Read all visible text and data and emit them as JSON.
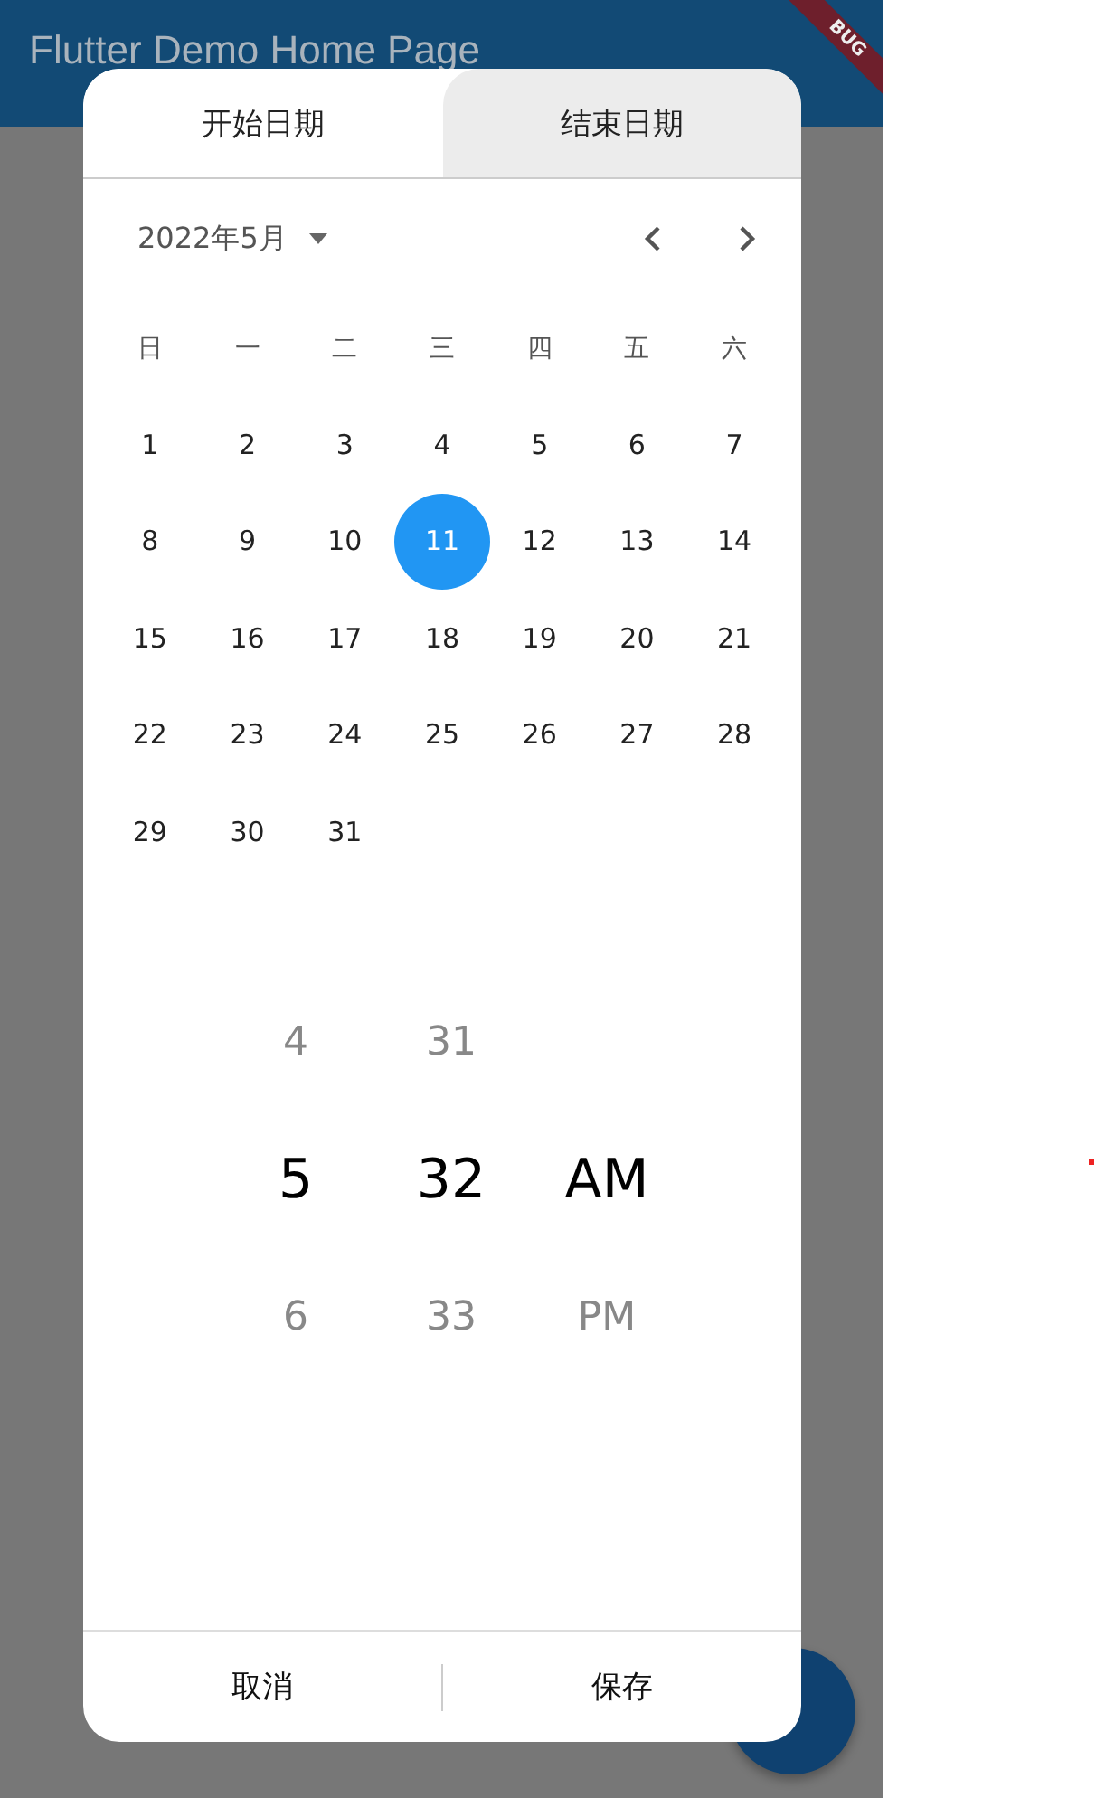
{
  "app_bar": {
    "title": "Flutter Demo Home Page"
  },
  "debug_banner": {
    "label": "BUG"
  },
  "dialog": {
    "tabs": [
      {
        "label": "开始日期",
        "selected": true
      },
      {
        "label": "结束日期",
        "selected": false
      }
    ],
    "month_label": "2022年5月",
    "weekdays": [
      "日",
      "一",
      "二",
      "三",
      "四",
      "五",
      "六"
    ],
    "days": [
      {
        "label": "1",
        "selected": false
      },
      {
        "label": "2",
        "selected": false
      },
      {
        "label": "3",
        "selected": false
      },
      {
        "label": "4",
        "selected": false
      },
      {
        "label": "5",
        "selected": false
      },
      {
        "label": "6",
        "selected": false
      },
      {
        "label": "7",
        "selected": false
      },
      {
        "label": "8",
        "selected": false
      },
      {
        "label": "9",
        "selected": false
      },
      {
        "label": "10",
        "selected": false
      },
      {
        "label": "11",
        "selected": true
      },
      {
        "label": "12",
        "selected": false
      },
      {
        "label": "13",
        "selected": false
      },
      {
        "label": "14",
        "selected": false
      },
      {
        "label": "15",
        "selected": false
      },
      {
        "label": "16",
        "selected": false
      },
      {
        "label": "17",
        "selected": false
      },
      {
        "label": "18",
        "selected": false
      },
      {
        "label": "19",
        "selected": false
      },
      {
        "label": "20",
        "selected": false
      },
      {
        "label": "21",
        "selected": false
      },
      {
        "label": "22",
        "selected": false
      },
      {
        "label": "23",
        "selected": false
      },
      {
        "label": "24",
        "selected": false
      },
      {
        "label": "25",
        "selected": false
      },
      {
        "label": "26",
        "selected": false
      },
      {
        "label": "27",
        "selected": false
      },
      {
        "label": "28",
        "selected": false
      },
      {
        "label": "29",
        "selected": false
      },
      {
        "label": "30",
        "selected": false
      },
      {
        "label": "31",
        "selected": false
      }
    ],
    "time_columns": [
      {
        "items": [
          {
            "label": "4",
            "selected": false
          },
          {
            "label": "5",
            "selected": true
          },
          {
            "label": "6",
            "selected": false
          }
        ]
      },
      {
        "items": [
          {
            "label": "31",
            "selected": false
          },
          {
            "label": "32",
            "selected": true
          },
          {
            "label": "33",
            "selected": false
          }
        ]
      },
      {
        "items": [
          {
            "label": "AM",
            "selected": true
          },
          {
            "label": "PM",
            "selected": false
          }
        ]
      }
    ],
    "buttons": [
      "取消",
      "保存"
    ]
  }
}
